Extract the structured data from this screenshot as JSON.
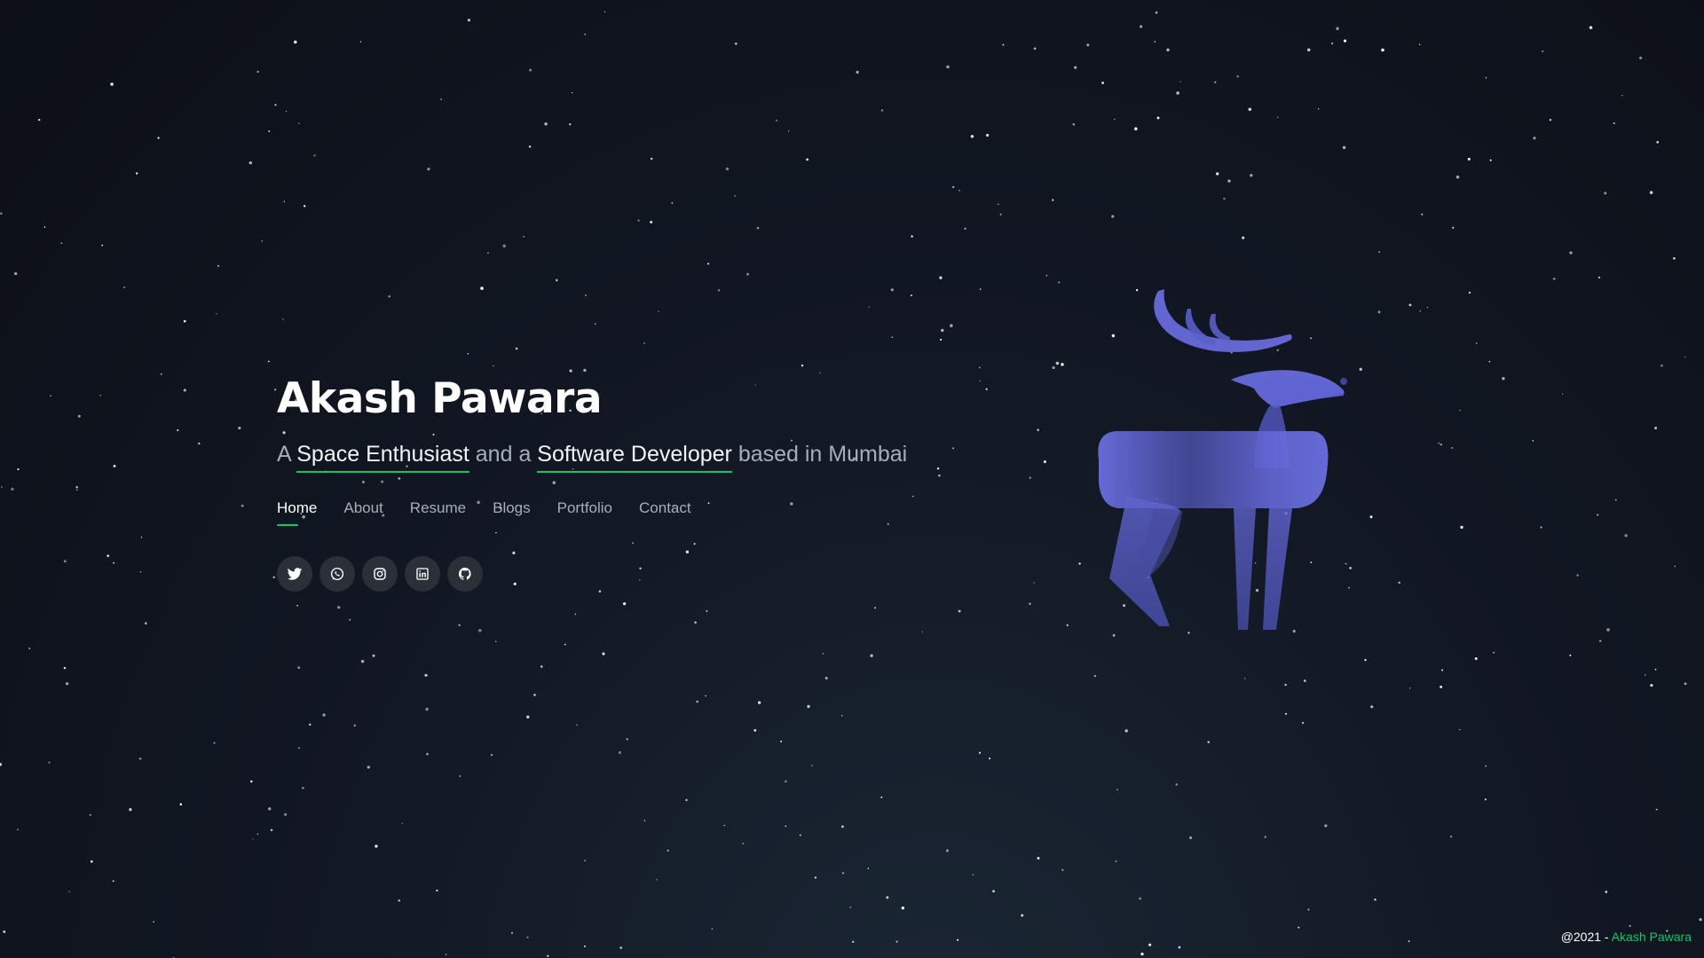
{
  "colors": {
    "accent": "#10c966",
    "text": "#ffffff",
    "muted": "#a8adb7",
    "deer": "#6a6ee0",
    "icon_bg": "#2a2f38"
  },
  "hero": {
    "title": "Akash Pawara",
    "subtitle": {
      "prefix": "A",
      "highlight1": "Space Enthusiast",
      "middle": "and a",
      "highlight2": "Software Developer",
      "suffix": "based in Mumbai"
    }
  },
  "nav": {
    "items": [
      {
        "label": "Home",
        "active": true
      },
      {
        "label": "About"
      },
      {
        "label": "Resume"
      },
      {
        "label": "Blogs"
      },
      {
        "label": "Portfolio"
      },
      {
        "label": "Contact"
      }
    ]
  },
  "socials": [
    {
      "icon": "twitter-icon"
    },
    {
      "icon": "whatsapp-icon"
    },
    {
      "icon": "instagram-icon"
    },
    {
      "icon": "linkedin-icon"
    },
    {
      "icon": "github-icon"
    }
  ],
  "footer": {
    "prefix": "@2021 - ",
    "author": "Akash Pawara"
  }
}
